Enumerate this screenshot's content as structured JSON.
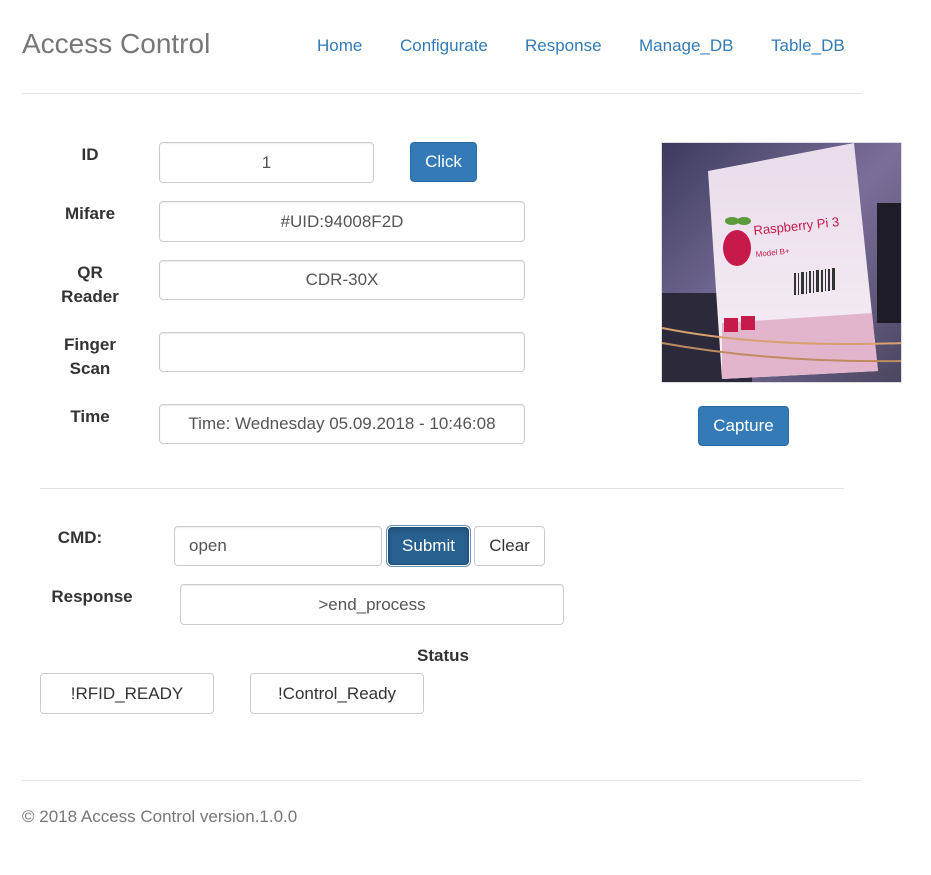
{
  "navbar": {
    "brand": "Access Control",
    "links": [
      "Home",
      "Configurate",
      "Response",
      "Manage_DB",
      "Table_DB"
    ]
  },
  "form": {
    "id_label": "ID",
    "id_value": "1",
    "click_label": "Click",
    "mifare_label": "Mifare",
    "mifare_value": "#UID:94008F2D",
    "qr_label_line1": "QR",
    "qr_label_line2": "Reader",
    "qr_value": "CDR-30X",
    "finger_label_line1": "Finger",
    "finger_label_line2": "Scan",
    "finger_value": "",
    "time_label": "Time",
    "time_value": "Time: Wednesday 05.09.2018 - 10:46:08"
  },
  "camera": {
    "card_title": "Raspberry Pi 3",
    "card_subtitle": "Model B+",
    "capture_label": "Capture"
  },
  "command": {
    "cmd_label": "CMD:",
    "cmd_value": "open",
    "submit_label": "Submit",
    "clear_label": "Clear",
    "response_label": "Response",
    "response_value": ">end_process"
  },
  "status": {
    "title": "Status",
    "rfid": "!RFID_READY",
    "control": "!Control_Ready"
  },
  "footer": {
    "text": "© 2018 Access Control version.1.0.0"
  },
  "colors": {
    "primary": "#337ab7",
    "primary_active": "#286090",
    "brand_text": "#777777"
  }
}
